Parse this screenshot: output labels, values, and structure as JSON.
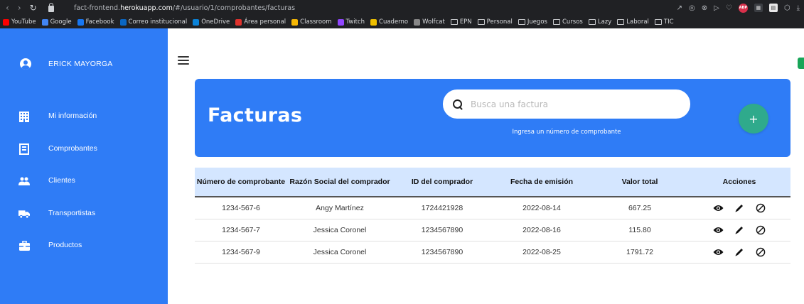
{
  "browser": {
    "url_prefix": "fact-frontend.",
    "url_host": "herokuapp.com",
    "url_path": "/#/usuario/1/comprobantes/facturas",
    "bookmarks": [
      {
        "label": "YouTube",
        "color": "#ff0000"
      },
      {
        "label": "Google",
        "color": "#4285f4"
      },
      {
        "label": "Facebook",
        "color": "#1877f2"
      },
      {
        "label": "Correo institucional",
        "color": "#0a66c2"
      },
      {
        "label": "OneDrive",
        "color": "#0a82d8"
      },
      {
        "label": "Área personal",
        "color": "#e0322d"
      },
      {
        "label": "Classroom",
        "color": "#f6b704"
      },
      {
        "label": "Twitch",
        "color": "#9146ff"
      },
      {
        "label": "Cuaderno",
        "color": "#f0c000"
      },
      {
        "label": "Wolfcat",
        "color": "#888888"
      },
      {
        "label": "EPN",
        "color": "folder"
      },
      {
        "label": "Personal",
        "color": "folder"
      },
      {
        "label": "Juegos",
        "color": "folder"
      },
      {
        "label": "Cursos",
        "color": "folder"
      },
      {
        "label": "Lazy",
        "color": "folder"
      },
      {
        "label": "Laboral",
        "color": "folder"
      },
      {
        "label": "TIC",
        "color": "folder"
      }
    ]
  },
  "sidebar": {
    "user_name": "ERICK MAYORGA",
    "items": [
      {
        "label": "Mi información",
        "icon": "building-icon"
      },
      {
        "label": "Comprobantes",
        "icon": "receipt-icon"
      },
      {
        "label": "Clientes",
        "icon": "people-icon"
      },
      {
        "label": "Transportistas",
        "icon": "truck-icon"
      },
      {
        "label": "Productos",
        "icon": "briefcase-icon"
      }
    ]
  },
  "header": {
    "title": "Facturas",
    "search_placeholder": "Busca una factura",
    "search_hint": "Ingresa un número de comprobante",
    "add_label": "+"
  },
  "table": {
    "headers": [
      "Número de comprobante",
      "Razón Social del comprador",
      "ID del comprador",
      "Fecha de emisión",
      "Valor total",
      "Acciones"
    ],
    "rows": [
      [
        "1234-567-6",
        "Angy Martínez",
        "1724421928",
        "2022-08-14",
        "667.25"
      ],
      [
        "1234-567-7",
        "Jessica Coronel",
        "1234567890",
        "2022-08-16",
        "115.80"
      ],
      [
        "1234-567-9",
        "Jessica Coronel",
        "1234567890",
        "2022-08-25",
        "1791.72"
      ]
    ]
  },
  "colors": {
    "primary": "#2f7cf6",
    "accent": "#2faa8c",
    "table_header": "#d4e6ff"
  }
}
